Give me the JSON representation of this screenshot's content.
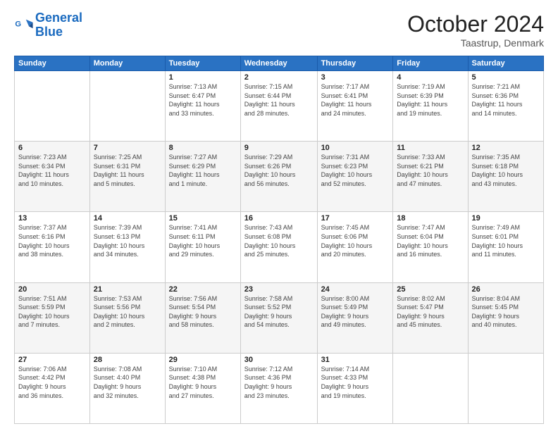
{
  "header": {
    "logo_line1": "General",
    "logo_line2": "Blue",
    "month": "October 2024",
    "location": "Taastrup, Denmark"
  },
  "days_of_week": [
    "Sunday",
    "Monday",
    "Tuesday",
    "Wednesday",
    "Thursday",
    "Friday",
    "Saturday"
  ],
  "weeks": [
    [
      {
        "day": "",
        "info": ""
      },
      {
        "day": "",
        "info": ""
      },
      {
        "day": "1",
        "info": "Sunrise: 7:13 AM\nSunset: 6:47 PM\nDaylight: 11 hours\nand 33 minutes."
      },
      {
        "day": "2",
        "info": "Sunrise: 7:15 AM\nSunset: 6:44 PM\nDaylight: 11 hours\nand 28 minutes."
      },
      {
        "day": "3",
        "info": "Sunrise: 7:17 AM\nSunset: 6:41 PM\nDaylight: 11 hours\nand 24 minutes."
      },
      {
        "day": "4",
        "info": "Sunrise: 7:19 AM\nSunset: 6:39 PM\nDaylight: 11 hours\nand 19 minutes."
      },
      {
        "day": "5",
        "info": "Sunrise: 7:21 AM\nSunset: 6:36 PM\nDaylight: 11 hours\nand 14 minutes."
      }
    ],
    [
      {
        "day": "6",
        "info": "Sunrise: 7:23 AM\nSunset: 6:34 PM\nDaylight: 11 hours\nand 10 minutes."
      },
      {
        "day": "7",
        "info": "Sunrise: 7:25 AM\nSunset: 6:31 PM\nDaylight: 11 hours\nand 5 minutes."
      },
      {
        "day": "8",
        "info": "Sunrise: 7:27 AM\nSunset: 6:29 PM\nDaylight: 11 hours\nand 1 minute."
      },
      {
        "day": "9",
        "info": "Sunrise: 7:29 AM\nSunset: 6:26 PM\nDaylight: 10 hours\nand 56 minutes."
      },
      {
        "day": "10",
        "info": "Sunrise: 7:31 AM\nSunset: 6:23 PM\nDaylight: 10 hours\nand 52 minutes."
      },
      {
        "day": "11",
        "info": "Sunrise: 7:33 AM\nSunset: 6:21 PM\nDaylight: 10 hours\nand 47 minutes."
      },
      {
        "day": "12",
        "info": "Sunrise: 7:35 AM\nSunset: 6:18 PM\nDaylight: 10 hours\nand 43 minutes."
      }
    ],
    [
      {
        "day": "13",
        "info": "Sunrise: 7:37 AM\nSunset: 6:16 PM\nDaylight: 10 hours\nand 38 minutes."
      },
      {
        "day": "14",
        "info": "Sunrise: 7:39 AM\nSunset: 6:13 PM\nDaylight: 10 hours\nand 34 minutes."
      },
      {
        "day": "15",
        "info": "Sunrise: 7:41 AM\nSunset: 6:11 PM\nDaylight: 10 hours\nand 29 minutes."
      },
      {
        "day": "16",
        "info": "Sunrise: 7:43 AM\nSunset: 6:08 PM\nDaylight: 10 hours\nand 25 minutes."
      },
      {
        "day": "17",
        "info": "Sunrise: 7:45 AM\nSunset: 6:06 PM\nDaylight: 10 hours\nand 20 minutes."
      },
      {
        "day": "18",
        "info": "Sunrise: 7:47 AM\nSunset: 6:04 PM\nDaylight: 10 hours\nand 16 minutes."
      },
      {
        "day": "19",
        "info": "Sunrise: 7:49 AM\nSunset: 6:01 PM\nDaylight: 10 hours\nand 11 minutes."
      }
    ],
    [
      {
        "day": "20",
        "info": "Sunrise: 7:51 AM\nSunset: 5:59 PM\nDaylight: 10 hours\nand 7 minutes."
      },
      {
        "day": "21",
        "info": "Sunrise: 7:53 AM\nSunset: 5:56 PM\nDaylight: 10 hours\nand 2 minutes."
      },
      {
        "day": "22",
        "info": "Sunrise: 7:56 AM\nSunset: 5:54 PM\nDaylight: 9 hours\nand 58 minutes."
      },
      {
        "day": "23",
        "info": "Sunrise: 7:58 AM\nSunset: 5:52 PM\nDaylight: 9 hours\nand 54 minutes."
      },
      {
        "day": "24",
        "info": "Sunrise: 8:00 AM\nSunset: 5:49 PM\nDaylight: 9 hours\nand 49 minutes."
      },
      {
        "day": "25",
        "info": "Sunrise: 8:02 AM\nSunset: 5:47 PM\nDaylight: 9 hours\nand 45 minutes."
      },
      {
        "day": "26",
        "info": "Sunrise: 8:04 AM\nSunset: 5:45 PM\nDaylight: 9 hours\nand 40 minutes."
      }
    ],
    [
      {
        "day": "27",
        "info": "Sunrise: 7:06 AM\nSunset: 4:42 PM\nDaylight: 9 hours\nand 36 minutes."
      },
      {
        "day": "28",
        "info": "Sunrise: 7:08 AM\nSunset: 4:40 PM\nDaylight: 9 hours\nand 32 minutes."
      },
      {
        "day": "29",
        "info": "Sunrise: 7:10 AM\nSunset: 4:38 PM\nDaylight: 9 hours\nand 27 minutes."
      },
      {
        "day": "30",
        "info": "Sunrise: 7:12 AM\nSunset: 4:36 PM\nDaylight: 9 hours\nand 23 minutes."
      },
      {
        "day": "31",
        "info": "Sunrise: 7:14 AM\nSunset: 4:33 PM\nDaylight: 9 hours\nand 19 minutes."
      },
      {
        "day": "",
        "info": ""
      },
      {
        "day": "",
        "info": ""
      }
    ]
  ]
}
